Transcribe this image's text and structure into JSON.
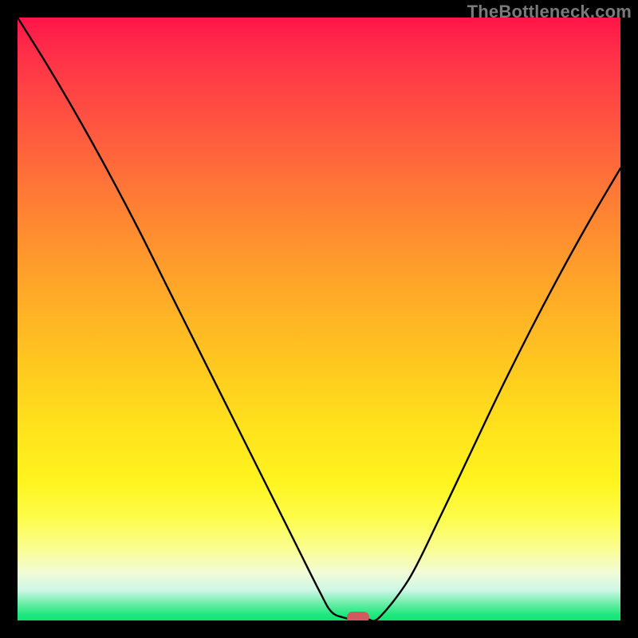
{
  "watermark": {
    "text": "TheBottleneck.com"
  },
  "colors": {
    "frame": "#000000",
    "curve": "#000000",
    "marker": "#d15a5f",
    "gradient_top": "#ff1548",
    "gradient_bottom": "#12e374"
  },
  "chart_data": {
    "type": "line",
    "title": "",
    "xlabel": "",
    "ylabel": "",
    "xlim": [
      0,
      100
    ],
    "ylim": [
      0,
      100
    ],
    "grid": false,
    "legend": false,
    "series": [
      {
        "name": "bottleneck-curve",
        "x": [
          0,
          5,
          10,
          15,
          20,
          25,
          30,
          35,
          40,
          45,
          50,
          52,
          54,
          56,
          58,
          60,
          65,
          70,
          75,
          80,
          85,
          90,
          95,
          100
        ],
        "values": [
          100,
          92,
          83.5,
          74.5,
          65,
          55,
          45,
          35,
          25,
          15,
          5,
          1.5,
          0.5,
          0.2,
          0.2,
          0.5,
          7,
          17,
          27.5,
          38,
          48,
          57.5,
          66.5,
          75
        ]
      }
    ],
    "annotations": [
      {
        "name": "optimal-point-marker",
        "x": 56.5,
        "y": 0.5
      }
    ],
    "background": "vertical-gradient red-to-green heatmap"
  }
}
